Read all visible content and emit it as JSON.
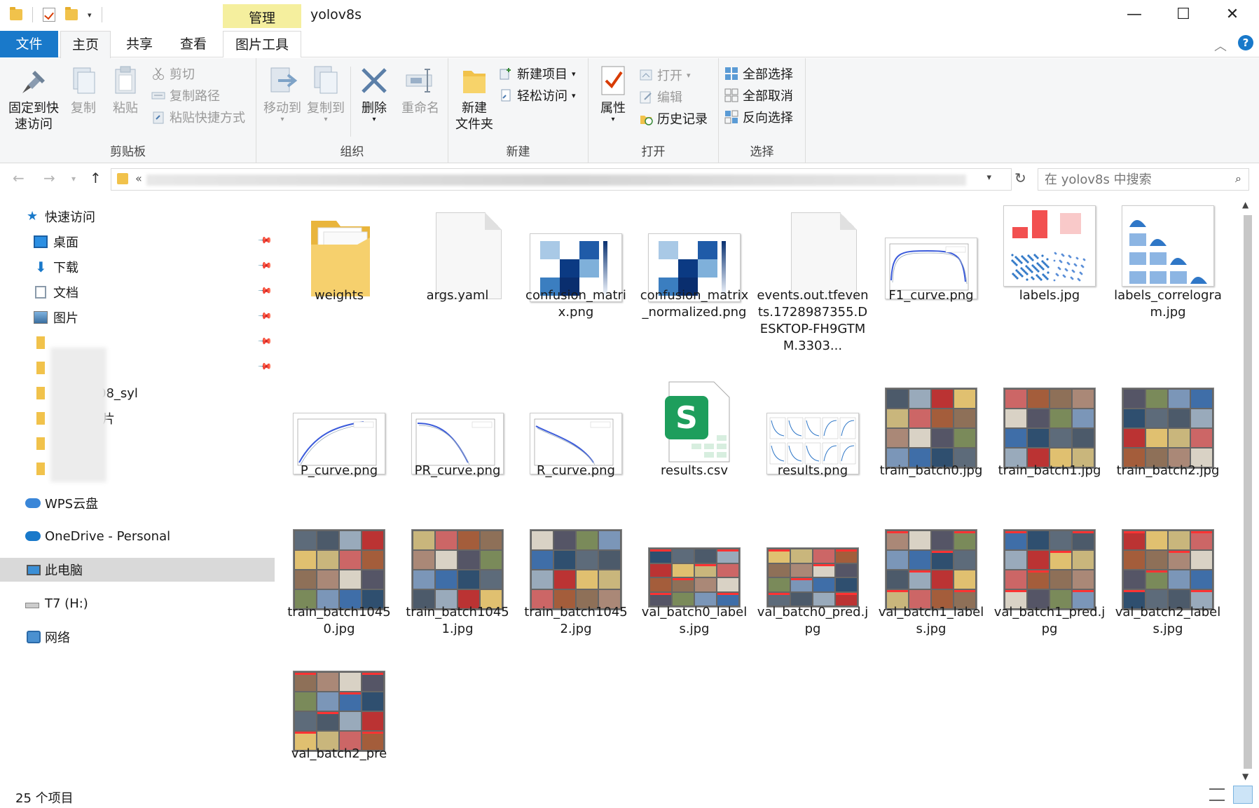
{
  "window": {
    "title": "yolov8s",
    "context_tab": "管理",
    "controls": {
      "minimize": "—",
      "maximize": "☐",
      "close": "✕"
    }
  },
  "tabs": {
    "file": "文件",
    "home": "主页",
    "share": "共享",
    "view": "查看",
    "picture_tools": "图片工具"
  },
  "ribbon": {
    "clipboard": {
      "label": "剪贴板",
      "pin_quick_access": "固定到快速访问",
      "pin_line1": "固定到快",
      "pin_line2": "速访问",
      "copy": "复制",
      "paste": "粘贴",
      "cut": "剪切",
      "copy_path": "复制路径",
      "paste_shortcut": "粘贴快捷方式"
    },
    "organize": {
      "label": "组织",
      "move_to": "移动到",
      "copy_to": "复制到",
      "delete": "删除",
      "rename": "重命名"
    },
    "new": {
      "label": "新建",
      "new_folder_line1": "新建",
      "new_folder_line2": "文件夹",
      "new_item": "新建项目",
      "easy_access": "轻松访问"
    },
    "open": {
      "label": "打开",
      "properties": "属性",
      "open": "打开",
      "edit": "编辑",
      "history": "历史记录"
    },
    "select": {
      "label": "选择",
      "select_all": "全部选择",
      "select_none": "全部取消",
      "invert": "反向选择"
    }
  },
  "address": {
    "prefix": "«",
    "search_placeholder": "在 yolov8s 中搜索"
  },
  "nav": {
    "quick_access": "快速访问",
    "desktop": "桌面",
    "downloads": "下载",
    "documents": "文档",
    "pictures": "图片",
    "blurred1": "",
    "blurred2": "",
    "partial3": "08_syl",
    "partial4": "片",
    "partial5": "",
    "blurred6": "",
    "wps": "WPS云盘",
    "onedrive": "OneDrive - Personal",
    "this_pc": "此电脑",
    "t7": "T7 (H:)",
    "network": "网络"
  },
  "files": [
    {
      "name": "weights",
      "type": "folder"
    },
    {
      "name": "args.yaml",
      "type": "doc"
    },
    {
      "name": "confusion_matrix.png",
      "type": "confusion"
    },
    {
      "name": "confusion_matrix_normalized.png",
      "type": "confusion"
    },
    {
      "name": "events.out.tfevents.1728987355.DESKTOP-FH9GTMM.3303...",
      "type": "doc"
    },
    {
      "name": "F1_curve.png",
      "type": "curve"
    },
    {
      "name": "labels.jpg",
      "type": "labels"
    },
    {
      "name": "labels_correlogram.jpg",
      "type": "correlogram"
    },
    {
      "name": "P_curve.png",
      "type": "curve"
    },
    {
      "name": "PR_curve.png",
      "type": "curve"
    },
    {
      "name": "R_curve.png",
      "type": "curve"
    },
    {
      "name": "results.csv",
      "type": "csv"
    },
    {
      "name": "results.png",
      "type": "results"
    },
    {
      "name": "train_batch0.jpg",
      "type": "mosaic"
    },
    {
      "name": "train_batch1.jpg",
      "type": "mosaic"
    },
    {
      "name": "train_batch2.jpg",
      "type": "mosaic"
    },
    {
      "name": "train_batch10450.jpg",
      "type": "mosaic"
    },
    {
      "name": "train_batch10451.jpg",
      "type": "mosaic"
    },
    {
      "name": "train_batch10452.jpg",
      "type": "mosaic"
    },
    {
      "name": "val_batch0_labels.jpg",
      "type": "mosaic"
    },
    {
      "name": "val_batch0_pred.jpg",
      "type": "mosaic"
    },
    {
      "name": "val_batch1_labels.jpg",
      "type": "mosaic"
    },
    {
      "name": "val_batch1_pred.jpg",
      "type": "mosaic"
    },
    {
      "name": "val_batch2_labels.jpg",
      "type": "mosaic"
    },
    {
      "name": "val_batch2_pre",
      "type": "mosaic"
    }
  ],
  "status": {
    "count": "25 个项目"
  },
  "colors": {
    "accent": "#1979ca",
    "manage_tab": "#f5ef9e",
    "selected_nav": "#d9d9d9",
    "folder": "#f1c24b",
    "csv_green": "#1e9e5c"
  }
}
